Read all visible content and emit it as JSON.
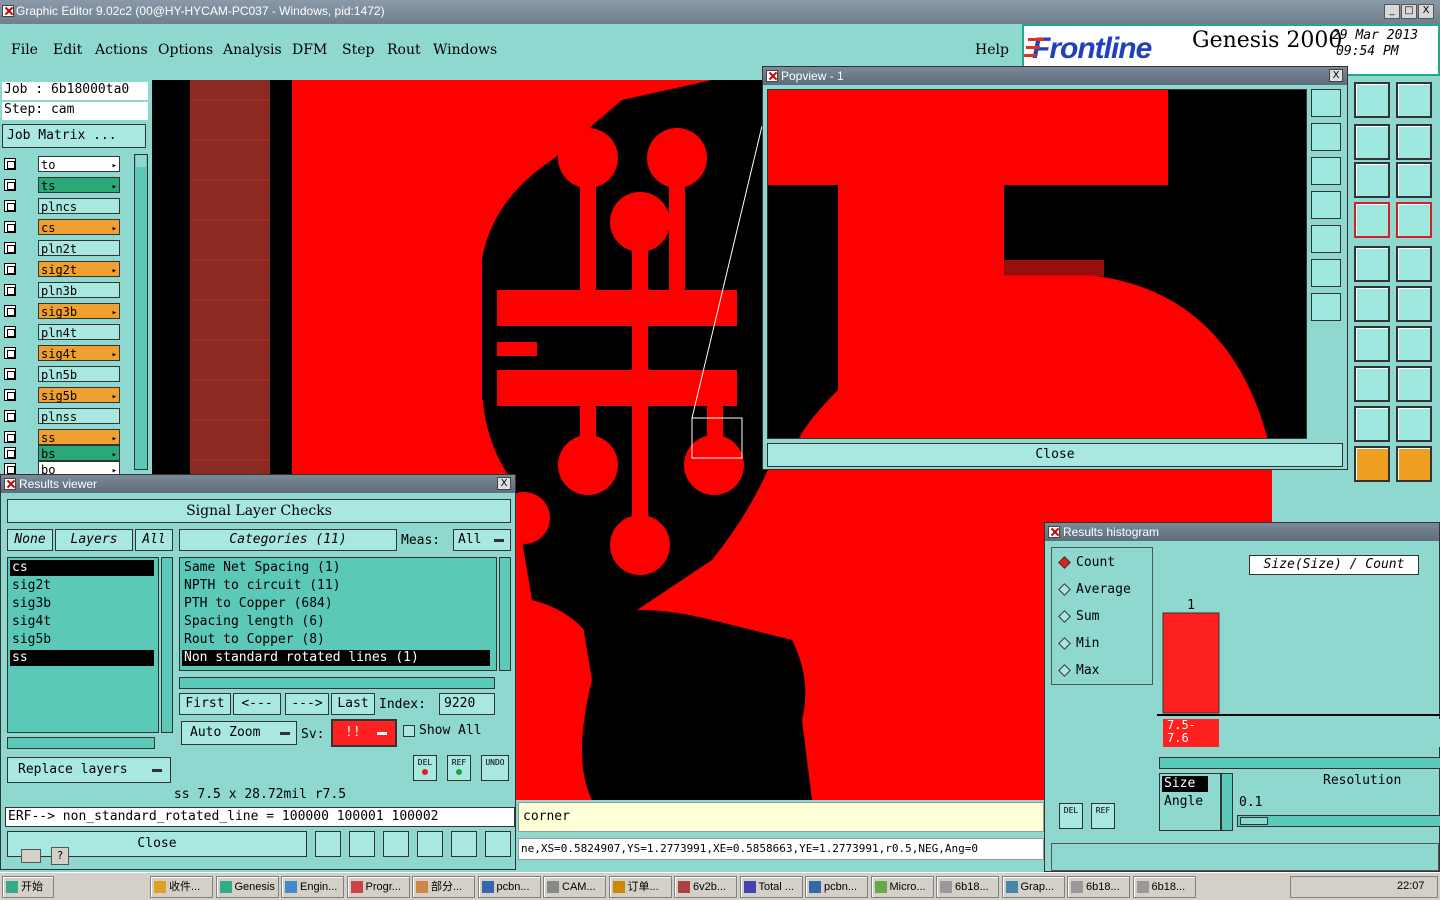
{
  "window": {
    "title": "Graphic Editor 9.02c2 (00@HY-HYCAM-PC037 - Windows, pid:1472)",
    "controls": [
      "_",
      "□",
      "X"
    ]
  },
  "menu": [
    "File",
    "Edit",
    "Actions",
    "Options",
    "Analysis",
    "DFM",
    "Step",
    "Rout",
    "Windows"
  ],
  "help": "Help",
  "brand": {
    "logo": "Frontline",
    "product": "Genesis 2000",
    "date": "29 Mar 2013",
    "time": "09:54 PM"
  },
  "job": {
    "job_label": "Job : 6b18000ta0",
    "step_label": "Step: cam",
    "matrix_button": "Job Matrix ..."
  },
  "layers": [
    {
      "name": "to",
      "color": "#ffffff",
      "tick": true
    },
    {
      "name": "ts",
      "color": "#2aa878",
      "tick": true
    },
    {
      "name": "plncs",
      "color": "#a8e8e0",
      "tick": false
    },
    {
      "name": "cs",
      "color": "#f0a030",
      "tick": true
    },
    {
      "name": "pln2t",
      "color": "#a8e8e0",
      "tick": false
    },
    {
      "name": "sig2t",
      "color": "#f0a030",
      "tick": true
    },
    {
      "name": "pln3b",
      "color": "#a8e8e0",
      "tick": false
    },
    {
      "name": "sig3b",
      "color": "#f0a030",
      "tick": true
    },
    {
      "name": "pln4t",
      "color": "#a8e8e0",
      "tick": false
    },
    {
      "name": "sig4t",
      "color": "#f0a030",
      "tick": true
    },
    {
      "name": "pln5b",
      "color": "#a8e8e0",
      "tick": false
    },
    {
      "name": "sig5b",
      "color": "#f0a030",
      "tick": true
    },
    {
      "name": "plnss",
      "color": "#a8e8e0",
      "tick": false
    },
    {
      "name": "ss",
      "color": "#f0a030",
      "tick": true
    },
    {
      "name": "bs",
      "color": "#2aa878",
      "tick": true
    },
    {
      "name": "bo",
      "color": "#ffffff",
      "tick": true
    }
  ],
  "popview": {
    "title": "Popview - 1",
    "close": "Close"
  },
  "results": {
    "title": "Results viewer",
    "heading": "Signal Layer Checks",
    "tabs": {
      "none": "None",
      "layers": "Layers",
      "all": "All"
    },
    "layer_list": [
      "cs",
      "sig2t",
      "sig3b",
      "sig4t",
      "sig5b",
      "ss"
    ],
    "categories_label": "Categories (11)",
    "meas_label": "Meas:",
    "meas_value": "All",
    "categories": [
      "Same Net Spacing (1)",
      "NPTH to circuit (11)",
      "PTH to Copper (684)",
      "Spacing length (6)",
      "Rout to Copper (8)",
      "Non standard rotated lines (1)"
    ],
    "nav": {
      "first": "First",
      "prev": "<---",
      "next": "--->",
      "last": "Last",
      "index_label": "Index:",
      "index_value": "9220"
    },
    "auto_zoom": "Auto Zoom",
    "sv_label": "Sv:",
    "sv_value": "!!",
    "show_all": "Show All",
    "replace_layers": "Replace layers",
    "icons": {
      "del": "DEL",
      "ref": "REF",
      "undo": "UNDO"
    },
    "measure": "ss 7.5 x 28.72mil  r7.5",
    "erf": "ERF--> non_standard_rotated_line = 100000 100001 100002",
    "close": "Close"
  },
  "status": {
    "corner": "corner",
    "coords": "ne,XS=0.5824907,YS=1.2773991,XE=0.5858663,YE=1.2773991,r0.5,NEG,Ang=0"
  },
  "histogram": {
    "title": "Results histogram",
    "modes": [
      "Count",
      "Average",
      "Sum",
      "Min",
      "Max"
    ],
    "selected_mode": "Count",
    "axis_title": "Size(Size) / Count",
    "chart_data": {
      "type": "bar",
      "categories": [
        "7.5-7.6"
      ],
      "values": [
        1
      ],
      "title": "Size(Size) / Count"
    },
    "bar_label": "1",
    "bin_label": "7.5-\n7.6",
    "list": [
      "Size",
      "Angle"
    ],
    "resolution_label": "Resolution",
    "resolution_value": "0.1",
    "icons": {
      "del": "DEL",
      "ref": "REF"
    }
  },
  "taskbar": {
    "start": "开始",
    "tasks": [
      "收件...",
      "Genesis",
      "Engin...",
      "Progr...",
      "部分...",
      "pcbn...",
      "CAM...",
      "订单...",
      "6v2b...",
      "Total ...",
      "pcbn...",
      "Micro...",
      "6b18...",
      "Grap...",
      "6b18...",
      "6b18..."
    ],
    "clock": "22:07"
  },
  "colors": {
    "teal": "#8fd8d0",
    "copper_red": "#ff0000",
    "title_blue": "#6f7f8e"
  }
}
